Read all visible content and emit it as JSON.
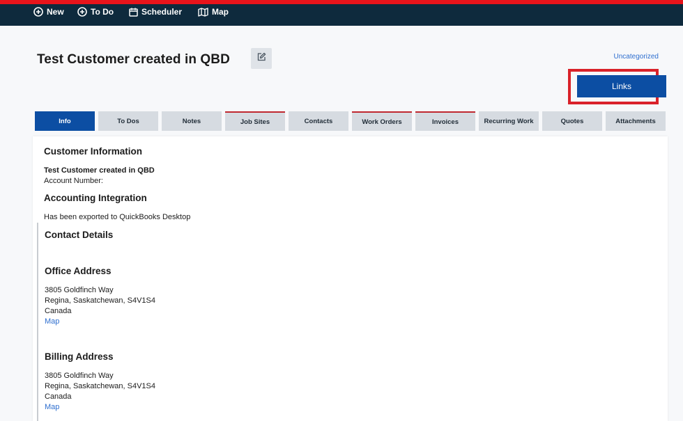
{
  "nav": {
    "new_label": "New",
    "todo_label": "To Do",
    "scheduler_label": "Scheduler",
    "map_label": "Map"
  },
  "header": {
    "title": "Test Customer created in QBD",
    "category": "Uncategorized",
    "links_label": "Links"
  },
  "tabs": [
    {
      "label": "Info",
      "active": true
    },
    {
      "label": "To Dos"
    },
    {
      "label": "Notes"
    },
    {
      "label": "Job Sites",
      "marked": true
    },
    {
      "label": "Contacts"
    },
    {
      "label": "Work Orders",
      "marked": true
    },
    {
      "label": "Invoices",
      "marked": true
    },
    {
      "label": "Recurring Work"
    },
    {
      "label": "Quotes"
    },
    {
      "label": "Attachments"
    }
  ],
  "customer": {
    "section_title": "Customer Information",
    "name": "Test Customer created in QBD",
    "account_number": "Account Number:"
  },
  "accounting": {
    "section_title": "Accounting Integration",
    "status": "Has been exported to QuickBooks Desktop"
  },
  "contact": {
    "section_title": "Contact Details"
  },
  "office_address": {
    "title": "Office Address",
    "line1": "3805 Goldfinch Way",
    "line2": "Regina, Saskatchewan, S4V1S4",
    "line3": "Canada",
    "map_label": "Map"
  },
  "billing_address": {
    "title": "Billing Address",
    "line1": "3805 Goldfinch Way",
    "line2": "Regina, Saskatchewan, S4V1S4",
    "line3": "Canada",
    "map_label": "Map"
  },
  "colors": {
    "topbar": "#0e2a3d",
    "topbar_accent": "#e8141b",
    "primary": "#0c4ea3",
    "link": "#2f6fcf",
    "highlight": "#d9222a"
  }
}
